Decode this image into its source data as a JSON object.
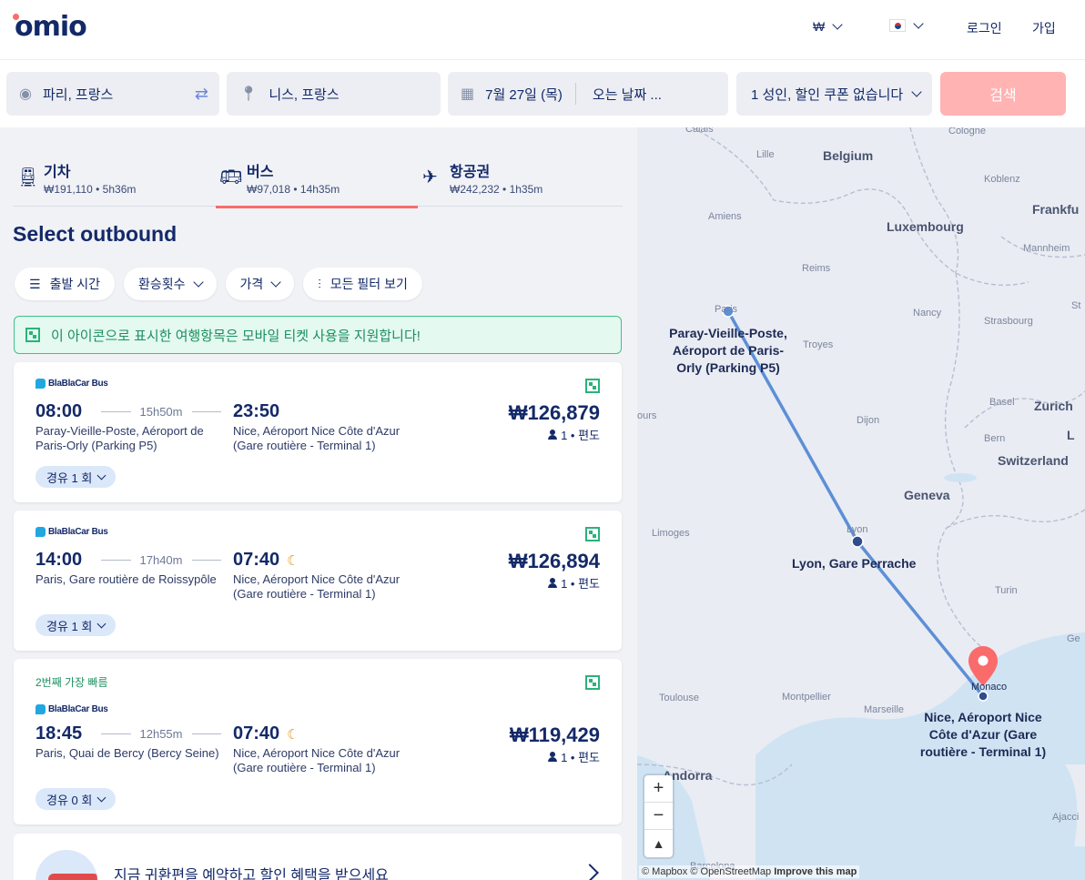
{
  "header": {
    "logo": "omio",
    "currency": "₩",
    "login": "로그인",
    "signup": "가입"
  },
  "search": {
    "from": "파리, 프랑스",
    "to": "니스, 프랑스",
    "depart_date": "7월 27일 (목)",
    "return_placeholder": "오는 날짜 ...",
    "passengers": "1 성인, 할인 쿠폰 없습니다",
    "search_button": "검색"
  },
  "tabs": [
    {
      "name": "기차",
      "summary": "₩191,110 • 5h36m"
    },
    {
      "name": "버스",
      "summary": "₩97,018 • 14h35m"
    },
    {
      "name": "항공권",
      "summary": "₩242,232 • 1h35m"
    }
  ],
  "page_title": "Select outbound",
  "filters": [
    "출발 시간",
    "환승횟수",
    "가격",
    "모든 필터 보기"
  ],
  "notice": "이 아이콘으로 표시한 여행항목은 모바일 티켓 사용을 지원합니다!",
  "results": [
    {
      "badge": "",
      "operator": "BlaBlaCar Bus",
      "depart": "08:00",
      "duration": "15h50m",
      "arrive": "23:50",
      "overnight": false,
      "from_station": "Paray-Vieille-Poste, Aéroport de Paris-Orly (Parking P5)",
      "to_station": "Nice, Aéroport Nice Côte d'Azur (Gare routière - Terminal 1)",
      "price": "₩126,879",
      "pax": "1 • 편도",
      "stops": "경유 1 회"
    },
    {
      "badge": "",
      "operator": "BlaBlaCar Bus",
      "depart": "14:00",
      "duration": "17h40m",
      "arrive": "07:40",
      "overnight": true,
      "from_station": "Paris, Gare routière de Roissypôle",
      "to_station": "Nice, Aéroport Nice Côte d'Azur (Gare routière - Terminal 1)",
      "price": "₩126,894",
      "pax": "1 • 편도",
      "stops": "경유 1 회"
    },
    {
      "badge": "2번째 가장 빠름",
      "operator": "BlaBlaCar Bus",
      "depart": "18:45",
      "duration": "12h55m",
      "arrive": "07:40",
      "overnight": true,
      "from_station": "Paris, Quai de Bercy (Bercy Seine)",
      "to_station": "Nice, Aéroport Nice Côte d'Azur (Gare routière - Terminal 1)",
      "price": "₩119,429",
      "pax": "1 • 편도",
      "stops": "경유 0 회"
    }
  ],
  "promo": "지금 귀환편을 예약하고 할인 혜택을 받으세요",
  "map": {
    "cities": [
      "Calais",
      "Cologne",
      "Lille",
      "Belgium",
      "Koblenz",
      "Amiens",
      "Frankfu",
      "Luxembourg",
      "Mannheim",
      "Reims",
      "Paris",
      "St",
      "Nancy",
      "Strasbourg",
      "Troyes",
      "ours",
      "Dijon",
      "Basel",
      "Zurich",
      "Bern",
      "L",
      "Switzerland",
      "Geneva",
      "Limoges",
      "Lyon",
      "Turin",
      "Ge",
      "Toulouse",
      "Montpellier",
      "Marseille",
      "Monaco",
      "Andorra",
      "Ajacci",
      "Barcelona"
    ],
    "stations": {
      "origin": "Paray-Vieille-Poste, Aéroport de Paris-Orly (Parking P5)",
      "via": "Lyon, Gare Perrache",
      "destination": "Nice, Aéroport Nice Côte d'Azur (Gare routière - Terminal 1)"
    },
    "zoom_in": "+",
    "zoom_out": "−",
    "compass": "▲",
    "attribution": "© Mapbox © OpenStreetMap",
    "improve": "Improve this map"
  }
}
